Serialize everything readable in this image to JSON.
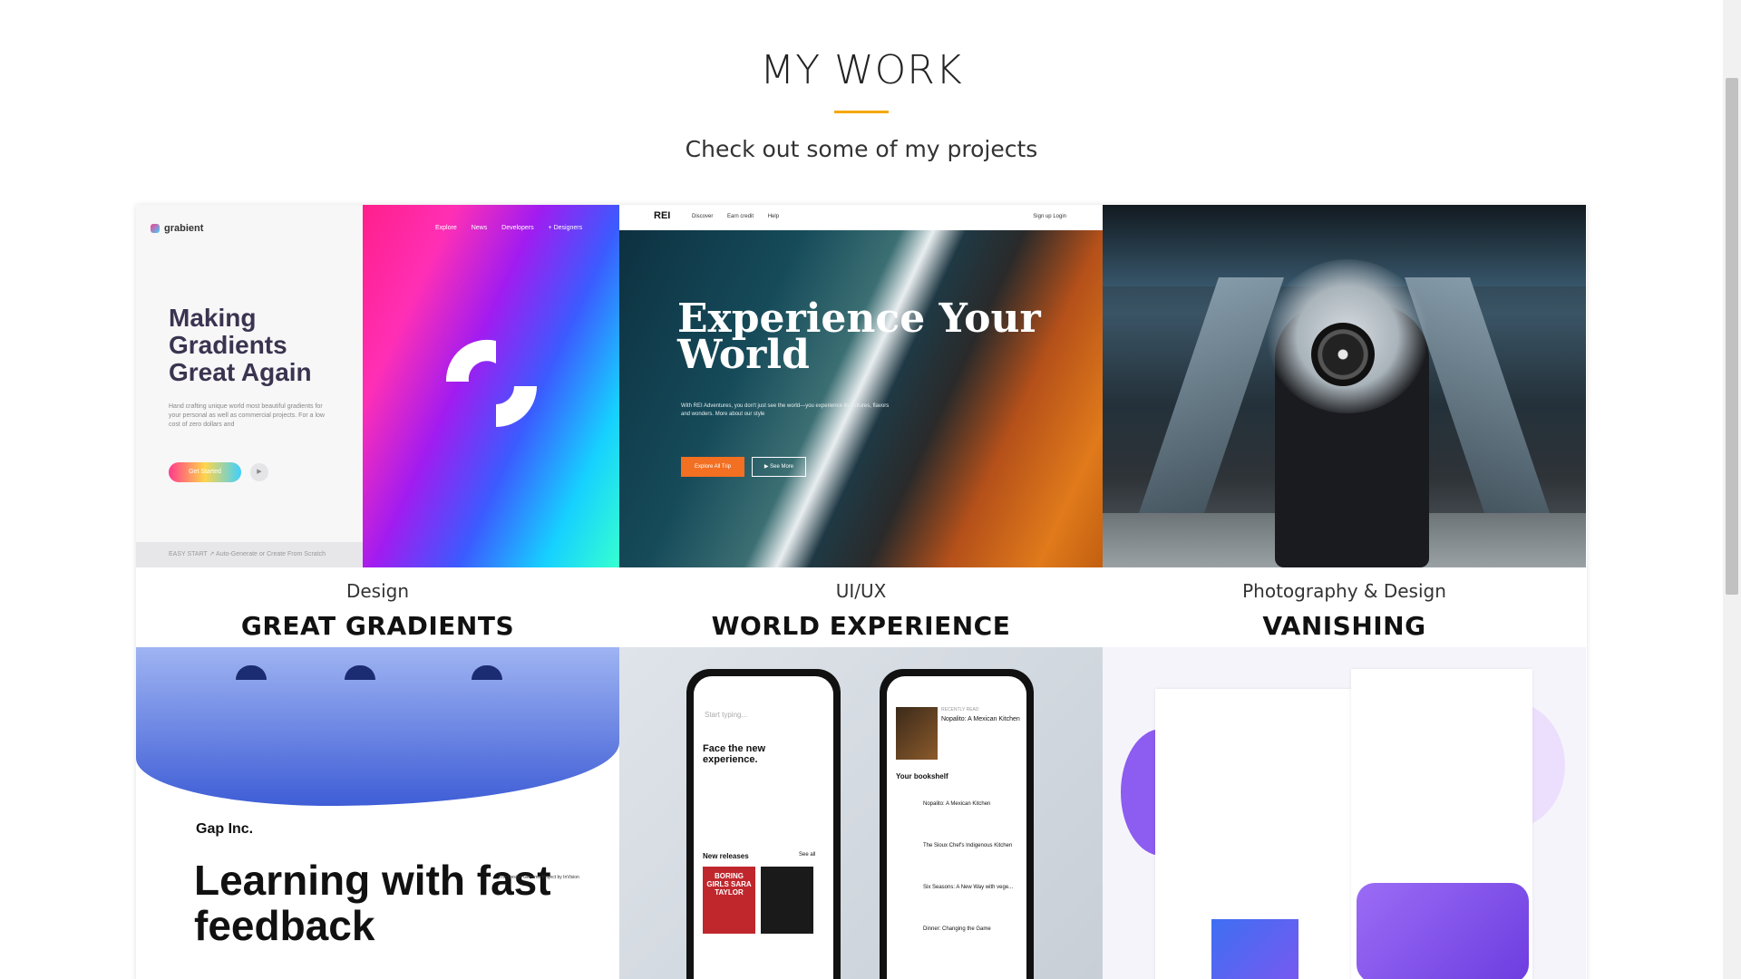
{
  "section": {
    "title": "MY WORK",
    "subtitle": "Check out some of my projects"
  },
  "colors": {
    "accent": "#f5a800"
  },
  "projects": [
    {
      "category": "Design",
      "title": "GREAT GRADIENTS"
    },
    {
      "category": "UI/UX",
      "title": "WORLD EXPERIENCE"
    },
    {
      "category": "Photography & Design",
      "title": "VANISHING"
    }
  ],
  "grabient": {
    "logo": "grabient",
    "nav": [
      "Explore",
      "News",
      "Developers",
      "+ Designers"
    ],
    "headline": "Making Gradients Great Again",
    "description": "Hand crafting unique world most beautiful gradients for your personal as well as commercial projects. For a low cost of zero dollars and",
    "button": "Get Started",
    "footer": "EASY START ↗   Auto-Generate or Create From Scratch"
  },
  "world": {
    "logo": "REI",
    "nav": [
      "Discover",
      "Earn credit",
      "Help"
    ],
    "right_nav": "Sign up   Login",
    "headline": "Experience Your World",
    "description": "With REI Adventures, you don't just see the world—you experience its cultures, flavors and wonders. More about our style",
    "button_primary": "Explore All Trip",
    "button_secondary": "▶ See More"
  },
  "gap": {
    "label": "Gap Inc.",
    "headline": "Learning with fast feedback",
    "note": "The Design Genome Project by InVision"
  },
  "apps": {
    "search_placeholder": "Start typing...",
    "promo_title": "Face the new experience.",
    "new_releases": "New releases",
    "see_all": "See all",
    "recently_read": "RECENTLY READ",
    "recent_book": "Nopalito: A Mexican Kitchen",
    "bookshelf": "Your bookshelf",
    "book_cover": "BORING GIRLS SARA TAYLOR",
    "shelf": [
      "Nopalito: A Mexican Kitchen",
      "The Sioux Chef's Indigenous Kitchen",
      "Six Seasons: A New Way with vege...",
      "Dinner: Changing the Game"
    ]
  }
}
